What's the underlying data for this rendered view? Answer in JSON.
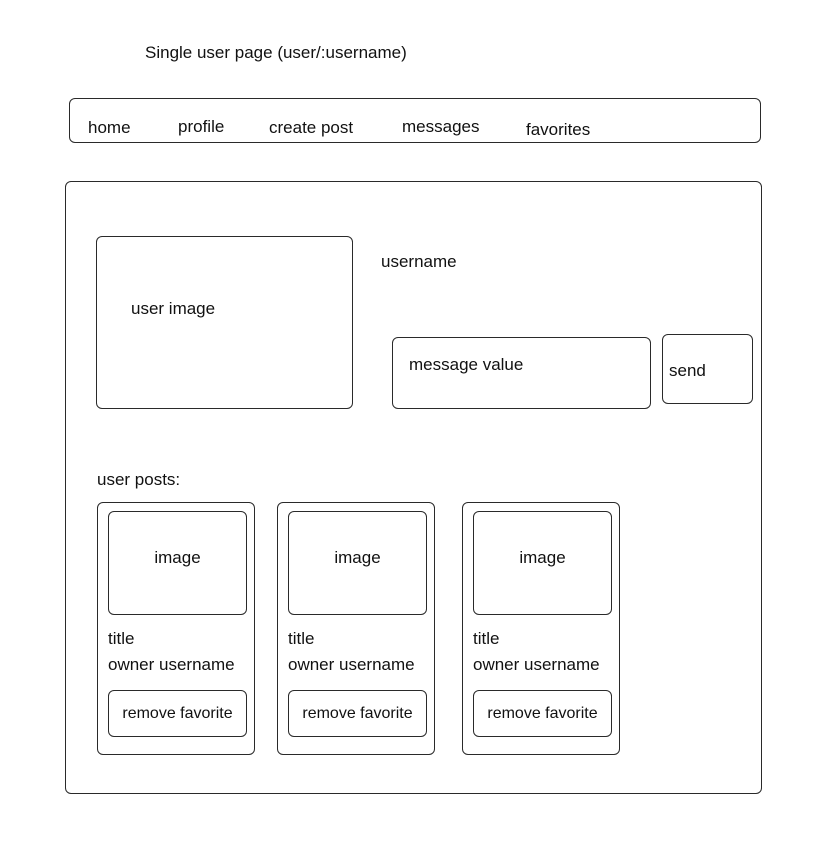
{
  "page": {
    "title": "Single user page (user/:username)"
  },
  "nav": {
    "items": [
      {
        "label": "home"
      },
      {
        "label": "profile"
      },
      {
        "label": "create post"
      },
      {
        "label": "messages"
      },
      {
        "label": "favorites"
      }
    ]
  },
  "profile": {
    "image_label": "user image",
    "username": "username",
    "message_placeholder": "message value",
    "send_label": "send"
  },
  "posts": {
    "heading": "user posts:",
    "cards": [
      {
        "image": "image",
        "title": "title",
        "owner": "owner username",
        "button": "remove favorite"
      },
      {
        "image": "image",
        "title": "title",
        "owner": "owner username",
        "button": "remove favorite"
      },
      {
        "image": "image",
        "title": "title",
        "owner": "owner username",
        "button": "remove favorite"
      }
    ]
  }
}
